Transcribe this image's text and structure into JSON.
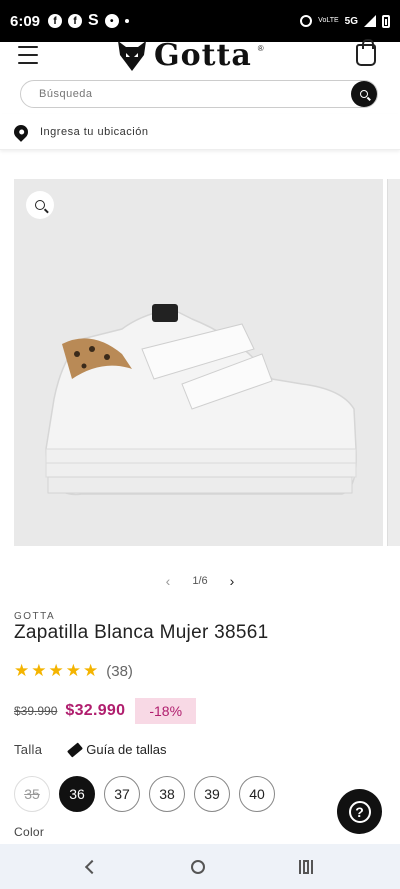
{
  "status_bar": {
    "time": "6:09",
    "network": "5G",
    "volte": "VoLTE"
  },
  "header": {
    "brand": "Gotta",
    "reg": "®"
  },
  "search": {
    "placeholder": "Búsqueda"
  },
  "location": {
    "label": "Ingresa tu ubicación"
  },
  "gallery": {
    "pager": "1/6"
  },
  "product": {
    "brand": "GOTTA",
    "title": "Zapatilla Blanca Mujer 38561",
    "rating": 5,
    "review_count": "(38)",
    "old_price": "$39.990",
    "price": "$32.990",
    "discount": "-18%",
    "size_label": "Talla",
    "size_guide": "Guía de tallas",
    "sizes": [
      {
        "label": "35",
        "state": "disabled"
      },
      {
        "label": "36",
        "state": "selected"
      },
      {
        "label": "37",
        "state": "available"
      },
      {
        "label": "38",
        "state": "available"
      },
      {
        "label": "39",
        "state": "available"
      },
      {
        "label": "40",
        "state": "available"
      }
    ],
    "color_label": "Color"
  },
  "colors": {
    "price": "#b01e6e",
    "discount_bg": "#f8d9e5",
    "star": "#f4b400"
  }
}
